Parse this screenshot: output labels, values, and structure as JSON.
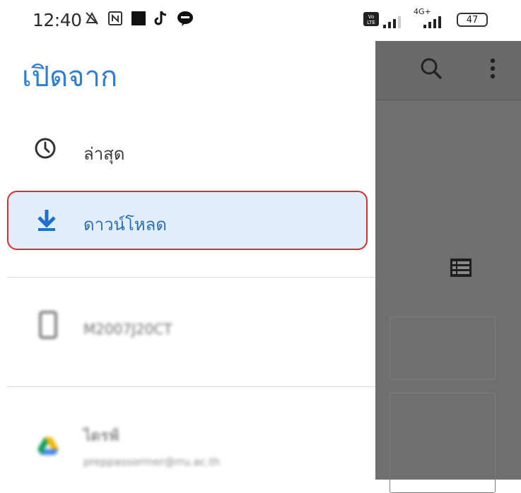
{
  "status_bar": {
    "time": "12:40",
    "icons": [
      "no-sound-icon",
      "nfc-icon",
      "square-icon",
      "tiktok-icon",
      "line-icon"
    ],
    "volte": "Vo LTE",
    "network": "4G+",
    "battery": "47"
  },
  "drawer": {
    "title": "เปิดจาก",
    "items": [
      {
        "label": "ล่าสุด",
        "icon": "clock-icon"
      },
      {
        "label": "ดาวน์โหลด",
        "icon": "download-icon",
        "selected": true
      },
      {
        "label": "M2007J20CT",
        "icon": "phone-icon"
      },
      {
        "label": "ไดรฟ์",
        "sub": "preppassorrner@rru.ac.th",
        "icon": "google-drive-icon"
      }
    ]
  },
  "colors": {
    "accent": "#2d7fd6",
    "selected_bg": "#e3eefb",
    "highlight_outline": "#e02b2b",
    "scrim": "#6f6f6f"
  }
}
